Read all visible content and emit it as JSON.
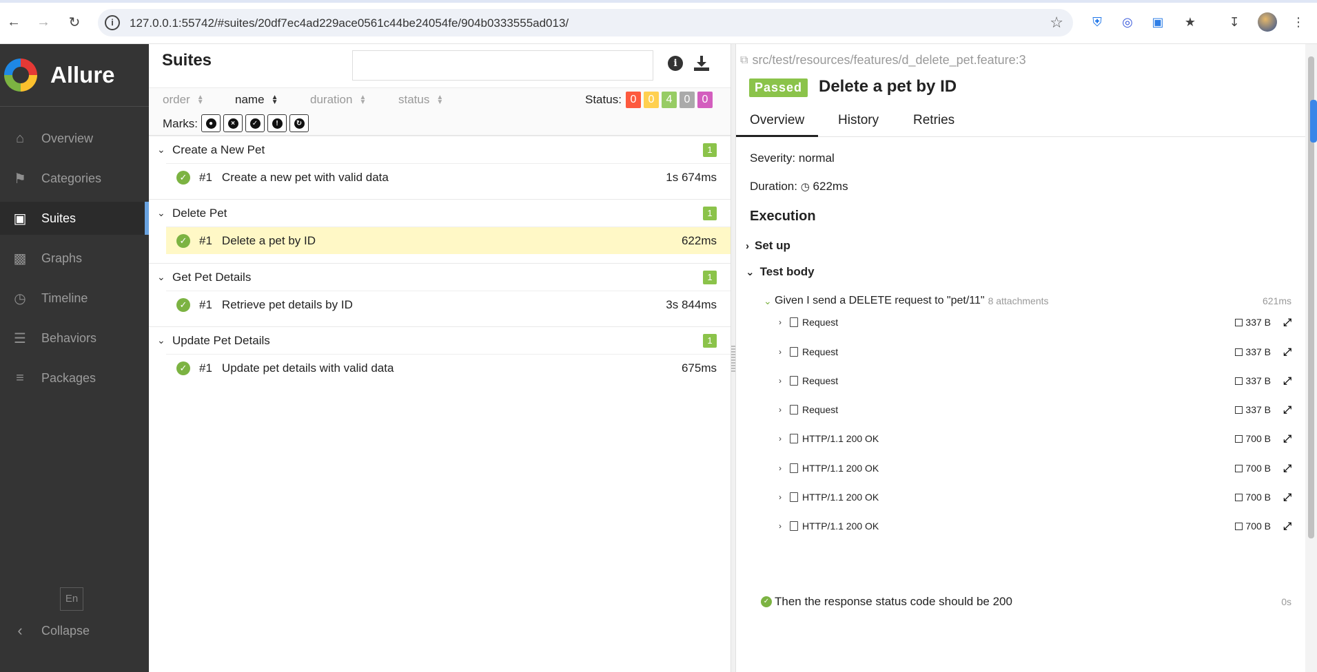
{
  "browser": {
    "url": "127.0.0.1:55742/#suites/20df7ec4ad229ace0561c44be24054fe/904b0333555ad013/"
  },
  "sidebar": {
    "brand": "Allure",
    "items": [
      {
        "label": "Overview",
        "icon": "home-icon"
      },
      {
        "label": "Categories",
        "icon": "flag-icon"
      },
      {
        "label": "Suites",
        "icon": "briefcase-icon"
      },
      {
        "label": "Graphs",
        "icon": "bar-chart-icon"
      },
      {
        "label": "Timeline",
        "icon": "clock-icon"
      },
      {
        "label": "Behaviors",
        "icon": "list-icon"
      },
      {
        "label": "Packages",
        "icon": "align-left-icon"
      }
    ],
    "active": "Suites",
    "lang": "En",
    "collapse": "Collapse"
  },
  "suites": {
    "title": "Suites",
    "search_value": "",
    "sort": {
      "order": "order",
      "name": "name",
      "duration": "duration",
      "status": "status"
    },
    "status_label": "Status:",
    "status_counts": [
      {
        "value": "0",
        "color": "#fd5a3e"
      },
      {
        "value": "0",
        "color": "#ffd050"
      },
      {
        "value": "4",
        "color": "#97cc64"
      },
      {
        "value": "0",
        "color": "#aaaaaa"
      },
      {
        "value": "0",
        "color": "#d35ebe"
      }
    ],
    "marks_label": "Marks:",
    "groups": [
      {
        "name": "Create a New Pet",
        "count": "1",
        "tests": [
          {
            "num": "#1",
            "name": "Create a new pet with valid data",
            "duration": "1s 674ms"
          }
        ]
      },
      {
        "name": "Delete Pet",
        "count": "1",
        "tests": [
          {
            "num": "#1",
            "name": "Delete a pet by ID",
            "duration": "622ms"
          }
        ]
      },
      {
        "name": "Get Pet Details",
        "count": "1",
        "tests": [
          {
            "num": "#1",
            "name": "Retrieve pet details by ID",
            "duration": "3s 844ms"
          }
        ]
      },
      {
        "name": "Update Pet Details",
        "count": "1",
        "tests": [
          {
            "num": "#1",
            "name": "Update pet details with valid data",
            "duration": "675ms"
          }
        ]
      }
    ]
  },
  "detail": {
    "path": "src/test/resources/features/d_delete_pet.feature:3",
    "status": "Passed",
    "title": "Delete a pet by ID",
    "tabs": [
      "Overview",
      "History",
      "Retries"
    ],
    "severity": "Severity: normal",
    "duration_label": "Duration:",
    "duration_value": "622ms",
    "execution": "Execution",
    "setup": "Set up",
    "test_body": "Test body",
    "given": {
      "text": "Given I send a DELETE request to \"pet/11\"",
      "attachments": "8 attachments",
      "duration": "621ms"
    },
    "attachments": [
      {
        "name": "Request",
        "size": "337 B"
      },
      {
        "name": "Request",
        "size": "337 B"
      },
      {
        "name": "Request",
        "size": "337 B"
      },
      {
        "name": "Request",
        "size": "337 B"
      },
      {
        "name": "HTTP/1.1 200 OK",
        "size": "700 B"
      },
      {
        "name": "HTTP/1.1 200 OK",
        "size": "700 B"
      },
      {
        "name": "HTTP/1.1 200 OK",
        "size": "700 B"
      },
      {
        "name": "HTTP/1.1 200 OK",
        "size": "700 B"
      }
    ],
    "then": {
      "text": "Then the response status code should be 200",
      "duration": "0s"
    }
  }
}
